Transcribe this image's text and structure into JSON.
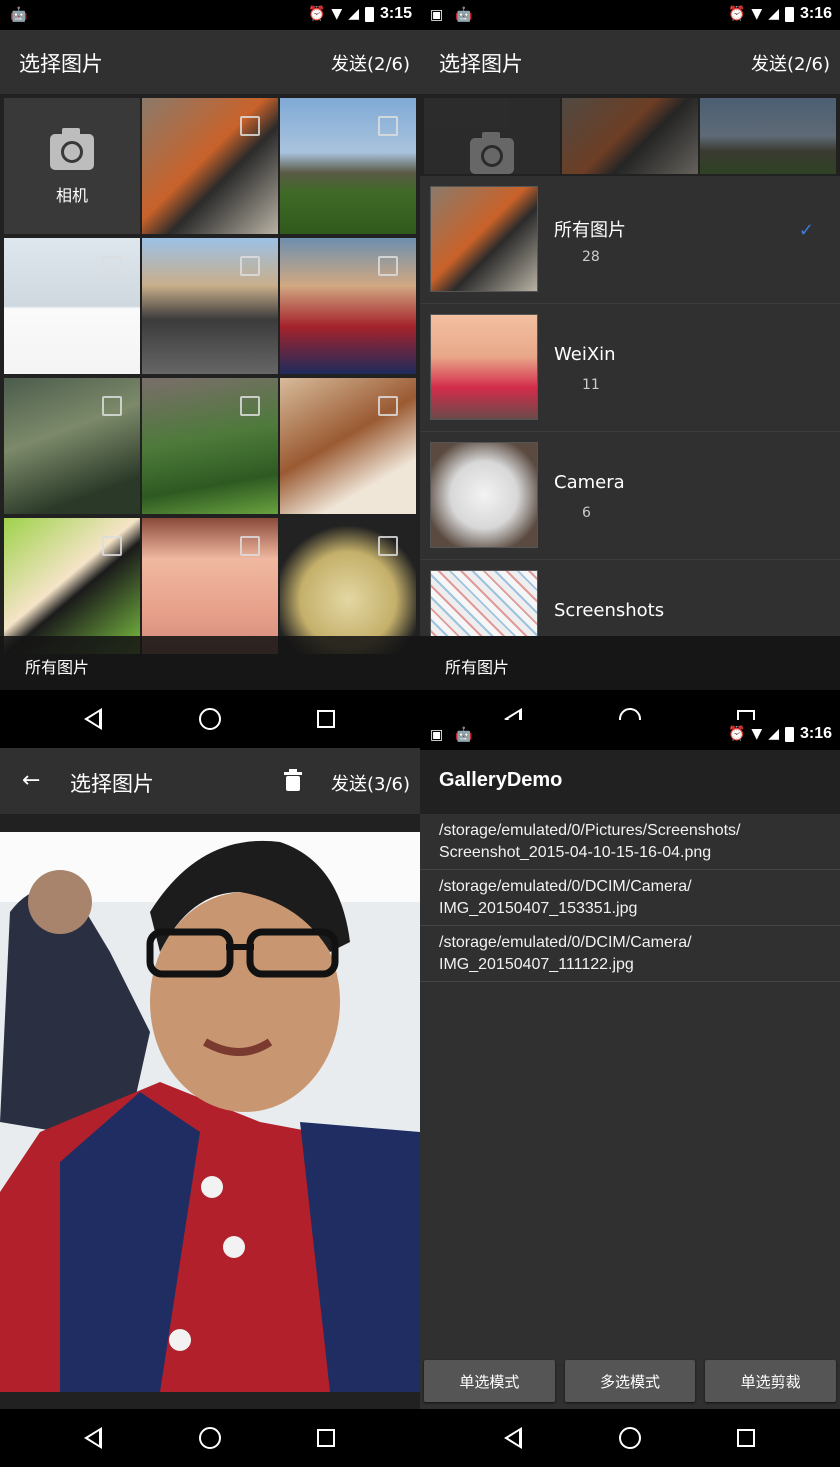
{
  "panel_grid": {
    "status": {
      "time": "3:15"
    },
    "title": "选择图片",
    "send": "发送(2/6)",
    "camera_label": "相机",
    "bottom_label": "所有图片"
  },
  "panel_albums": {
    "status": {
      "time": "3:16"
    },
    "title": "选择图片",
    "send": "发送(2/6)",
    "albums": [
      {
        "name": "所有图片",
        "count": "28",
        "selected": true
      },
      {
        "name": "WeiXin",
        "count": "11",
        "selected": false
      },
      {
        "name": "Camera",
        "count": "6",
        "selected": false
      },
      {
        "name": "Screenshots",
        "count": "",
        "selected": false
      }
    ],
    "bottom_label": "所有图片"
  },
  "panel_detail": {
    "back_icon": "arrow-back-icon",
    "title": "选择图片",
    "send": "发送(3/6)"
  },
  "panel_demo": {
    "status": {
      "time": "3:16"
    },
    "title": "GalleryDemo",
    "paths": [
      {
        "line1": "/storage/emulated/0/Pictures/Screenshots/",
        "line2": "Screenshot_2015-04-10-15-16-04.png"
      },
      {
        "line1": "/storage/emulated/0/DCIM/Camera/",
        "line2": "IMG_20150407_153351.jpg"
      },
      {
        "line1": "/storage/emulated/0/DCIM/Camera/",
        "line2": "IMG_20150407_111122.jpg"
      }
    ],
    "buttons": [
      "单选模式",
      "多选模式",
      "单选剪裁"
    ]
  },
  "colors": {
    "accent": "#3d7bdc",
    "appbar": "#303030",
    "background": "#212121"
  }
}
